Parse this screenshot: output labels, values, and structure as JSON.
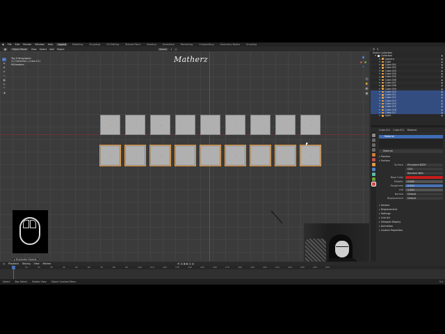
{
  "menubar": {
    "menus": [
      "File",
      "Edit",
      "Render",
      "Window",
      "Help"
    ],
    "workspaces": [
      "Layout",
      "Modeling",
      "Sculpting",
      "UV Editing",
      "Texture Paint",
      "Shading",
      "Animation",
      "Rendering",
      "Compositing",
      "Geometry Nodes",
      "Scripting"
    ],
    "active_workspace": "Layout"
  },
  "viewport": {
    "mode": "Object Mode",
    "menus": [
      "View",
      "Select",
      "Add",
      "Object"
    ],
    "transform": "Global",
    "info_line1": "Top Orthographic",
    "info_line2": "(1) Collection | Cube.011",
    "info_line3": "Millimeters",
    "watermark": "Matherz",
    "last_operator": "▸ Duplicate Objects",
    "tools": [
      "▸",
      "⊕",
      "✥",
      "⟳",
      "⤡",
      "▦",
      "✎",
      "⌒",
      "◢"
    ]
  },
  "outliner": {
    "header": "Scene Collection",
    "rows": [
      {
        "label": "Collection",
        "type": "coll"
      },
      {
        "label": "Camera",
        "type": "obj"
      },
      {
        "label": "Cube",
        "type": "obj"
      },
      {
        "label": "Cube.001",
        "type": "obj"
      },
      {
        "label": "Cube.002",
        "type": "obj"
      },
      {
        "label": "Cube.003",
        "type": "obj"
      },
      {
        "label": "Cube.004",
        "type": "obj"
      },
      {
        "label": "Cube.005",
        "type": "obj"
      },
      {
        "label": "Cube.006",
        "type": "obj"
      },
      {
        "label": "Cube.007",
        "type": "obj"
      },
      {
        "label": "Cube.008",
        "type": "obj"
      },
      {
        "label": "Cube.009",
        "type": "obj"
      },
      {
        "label": "Cube.010",
        "type": "sel"
      },
      {
        "label": "Cube.011",
        "type": "sel"
      },
      {
        "label": "Cube.012",
        "type": "sel"
      },
      {
        "label": "Cube.013",
        "type": "sel"
      },
      {
        "label": "Cube.014",
        "type": "sel"
      },
      {
        "label": "Cube.015",
        "type": "sel"
      },
      {
        "label": "Cube.016",
        "type": "sel"
      },
      {
        "label": "Cube.017",
        "type": "sel"
      },
      {
        "label": "Light",
        "type": "obj"
      }
    ]
  },
  "properties": {
    "header_items": [
      "Cube.011",
      "Cube.011",
      "Material"
    ],
    "slot_name": "Material",
    "material_name": "Material",
    "sections": [
      "Preview",
      "Surface",
      "Volume",
      "Displacement",
      "Settings",
      "Line Art",
      "Viewport Display",
      "Animation",
      "Custom Properties"
    ],
    "fields": [
      {
        "label": "Surface",
        "value": "Principled BSDF",
        "style": "dark"
      },
      {
        "label": "",
        "value": "GGX",
        "style": "dark"
      },
      {
        "label": "",
        "value": "Random Walk",
        "style": "dark"
      },
      {
        "label": "Base Color",
        "value": "",
        "style": "red"
      },
      {
        "label": "Metallic",
        "value": "0.000",
        "style": ""
      },
      {
        "label": "Roughness",
        "value": "0.500",
        "style": "blue"
      },
      {
        "label": "IOR",
        "value": "1.450",
        "style": ""
      },
      {
        "label": "Normal",
        "value": "Default",
        "style": "dark"
      },
      {
        "label": "Displacement",
        "value": "Default",
        "style": "dark"
      }
    ]
  },
  "timeline": {
    "menus": [
      "Playback",
      "Keying",
      "View",
      "Marker"
    ],
    "ticks": [
      "0",
      "10",
      "20",
      "30",
      "40",
      "50",
      "60",
      "70",
      "80",
      "90",
      "100",
      "110",
      "120",
      "130",
      "140",
      "150",
      "160",
      "170",
      "180",
      "190",
      "200",
      "210",
      "220",
      "230",
      "240",
      "250"
    ],
    "current_frame": "1",
    "start": "1",
    "end": "250"
  },
  "status": {
    "items": [
      "Select",
      "Box Select",
      "Rotate View",
      "Object Context Menu"
    ],
    "right": "3.4"
  },
  "colors": {
    "accent": "#4772b3",
    "base_color": "#c81c1c",
    "plane": "#b0b0b0"
  }
}
